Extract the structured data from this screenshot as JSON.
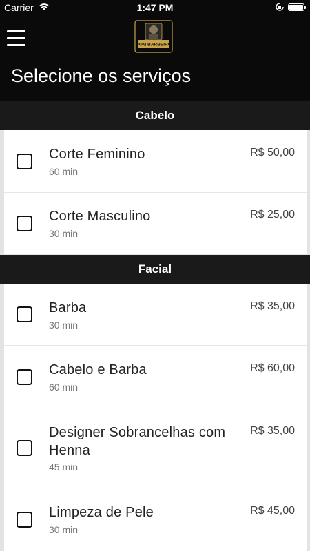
{
  "status": {
    "carrier": "Carrier",
    "time": "1:47 PM"
  },
  "header": {
    "menu_icon": "hamburger-menu-icon",
    "logo_icon": "barbershop-logo-icon",
    "logo_text": "DOM BARBEIRO",
    "title": "Selecione os serviços"
  },
  "sections": [
    {
      "title": "Cabelo",
      "items": [
        {
          "name": "Corte Feminino",
          "duration": "60 min",
          "price": "R$ 50,00",
          "checked": false
        },
        {
          "name": "Corte Masculino",
          "duration": "30 min",
          "price": "R$ 25,00",
          "checked": false
        }
      ]
    },
    {
      "title": "Facial",
      "items": [
        {
          "name": "Barba",
          "duration": "30 min",
          "price": "R$ 35,00",
          "checked": false
        },
        {
          "name": "Cabelo e Barba",
          "duration": "60 min",
          "price": "R$ 60,00",
          "checked": false
        },
        {
          "name": "Designer Sobrancelhas com Henna",
          "duration": "45 min",
          "price": "R$ 35,00",
          "checked": false
        },
        {
          "name": "Limpeza de Pele",
          "duration": "30 min",
          "price": "R$ 45,00",
          "checked": false
        }
      ]
    }
  ],
  "colors": {
    "header_bg": "#0a0a0a",
    "section_bg": "#1a1a1a",
    "page_bg": "#e3e3e3",
    "card_bg": "#ffffff",
    "logo_gold": "#c9a44a"
  }
}
